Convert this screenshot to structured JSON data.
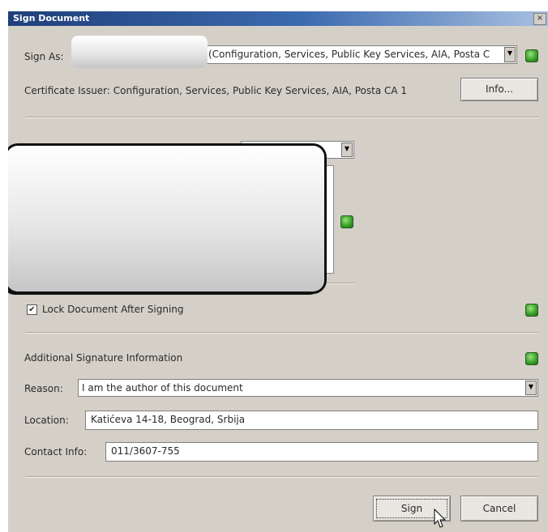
{
  "dialog": {
    "title": "Sign Document",
    "close_glyph": "×"
  },
  "sign_as": {
    "label": "Sign As:",
    "value": "(Configuration, Services, Public Key Services, AIA, Posta C"
  },
  "issuer": {
    "text": "Certificate Issuer: Configuration, Services, Public Key Services, AIA, Posta CA 1",
    "info_button": "Info..."
  },
  "lock": {
    "checked": "✔",
    "label": "Lock Document After Signing"
  },
  "additional": {
    "heading": "Additional Signature Information",
    "reason_label": "Reason:",
    "reason_value": "I am the author of this document",
    "location_label": "Location:",
    "location_value": "Katićeva 14-18, Beograd, Srbija",
    "contact_label": "Contact Info:",
    "contact_value": "011/3607-755"
  },
  "buttons": {
    "sign": "Sign",
    "cancel": "Cancel"
  },
  "icons": {
    "status_indicator": "green-status-icon",
    "cursor": "mouse-pointer-icon"
  },
  "colors": {
    "dialog_bg": "#d4d0c8",
    "title_bar": "#1f3f7a",
    "status_green": "#3aa62a"
  }
}
